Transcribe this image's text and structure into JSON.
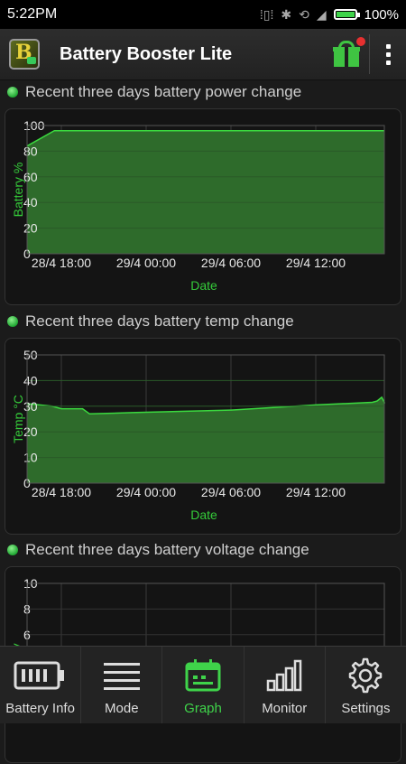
{
  "status_bar": {
    "time": "5:22PM",
    "battery_percent": "100%",
    "battery_level": 1.0
  },
  "app": {
    "title": "Battery Booster Lite",
    "logo_letter": "B"
  },
  "sections": [
    {
      "title": "Recent three days battery power change"
    },
    {
      "title": "Recent three days battery temp change"
    },
    {
      "title": "Recent three days battery voltage change"
    }
  ],
  "chart_data": [
    {
      "type": "area",
      "xlabel": "Date",
      "ylabel": "Battery %",
      "ylim": [
        0,
        100
      ],
      "y_ticks": [
        "0",
        "20",
        "40",
        "60",
        "80",
        "100"
      ],
      "x_ticks": [
        "28/4 18:00",
        "29/4 00:00",
        "29/4 06:00",
        "29/4 12:00"
      ],
      "grid": true,
      "color": "#2e6b2b",
      "line_color": "#3bd93f",
      "series": [
        {
          "x": [
            "28/4 16:48",
            "28/4 17:30",
            "28/4 18:00",
            "29/4 12:00",
            "29/4 17:22"
          ],
          "values": [
            84,
            96,
            96,
            96,
            96
          ]
        }
      ]
    },
    {
      "type": "area",
      "xlabel": "Date",
      "ylabel": "Temp °C",
      "ylim": [
        0,
        50
      ],
      "y_ticks": [
        "0",
        "10",
        "20",
        "30",
        "40",
        "50"
      ],
      "x_ticks": [
        "28/4 18:00",
        "29/4 00:00",
        "29/4 06:00",
        "29/4 12:00"
      ],
      "grid": true,
      "color": "#2e6b2b",
      "line_color": "#3bd93f",
      "series": [
        {
          "x": [
            "28/4 16:48",
            "28/4 17:20",
            "28/4 18:00",
            "28/4 19:30",
            "28/4 20:00",
            "28/4 23:00",
            "29/4 06:00",
            "29/4 12:00",
            "29/4 16:00",
            "29/4 16:20",
            "29/4 16:40",
            "29/4 17:00",
            "29/4 17:22"
          ],
          "values": [
            31,
            30,
            29,
            29,
            27,
            27.5,
            28.5,
            30.5,
            31.5,
            32,
            33.5,
            31.5,
            31
          ]
        }
      ]
    },
    {
      "type": "area",
      "xlabel": "",
      "ylabel": "V",
      "ylim": [
        0,
        10
      ],
      "y_ticks": [
        "6",
        "8",
        "10"
      ],
      "x_ticks": [],
      "grid": true,
      "color": "#2e6b2b",
      "line_color": "#3bd93f",
      "series": []
    }
  ],
  "bottom_nav": [
    {
      "label": "Battery Info",
      "icon": "battery-info-icon",
      "active": false
    },
    {
      "label": "Mode",
      "icon": "mode-list-icon",
      "active": false
    },
    {
      "label": "Graph",
      "icon": "graph-calendar-icon",
      "active": true
    },
    {
      "label": "Monitor",
      "icon": "monitor-bars-icon",
      "active": false
    },
    {
      "label": "Settings",
      "icon": "settings-gear-icon",
      "active": false
    }
  ]
}
